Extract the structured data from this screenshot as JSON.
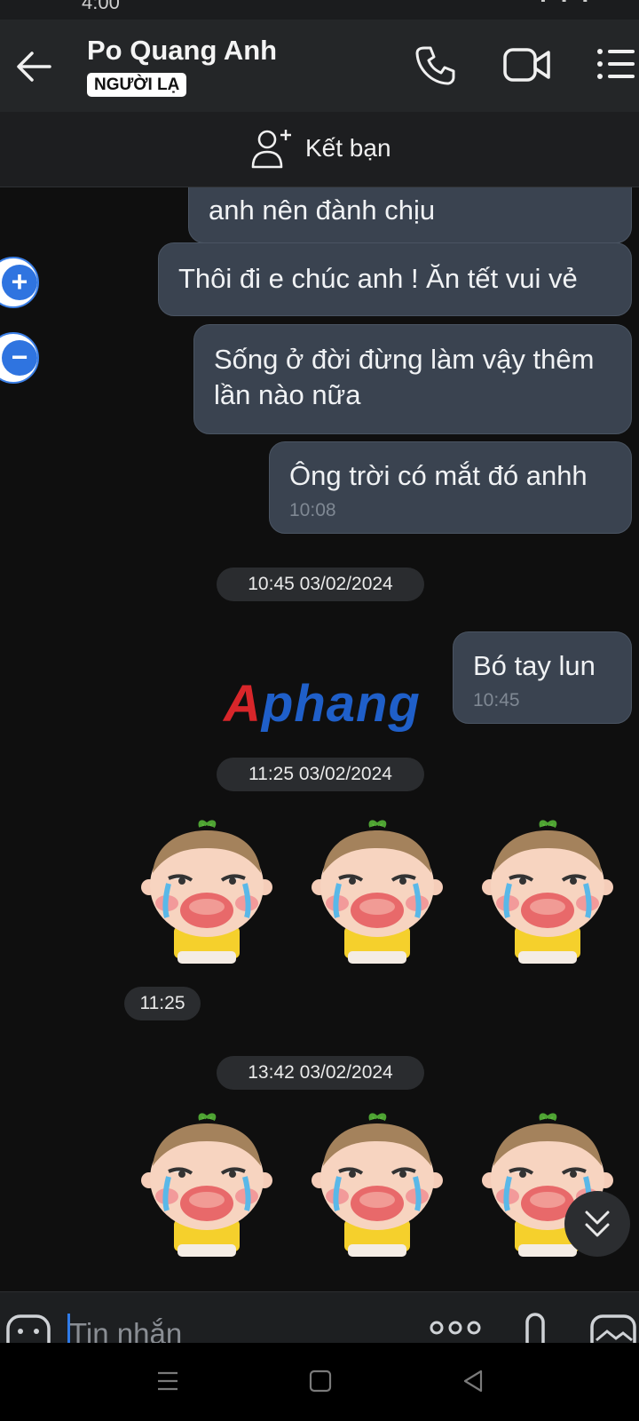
{
  "status_bar": {
    "time": "4:00"
  },
  "header": {
    "contact_name": "Po Quang Anh",
    "badge": "NGƯỜI LẠ",
    "icons": [
      "back-arrow-icon",
      "phone-icon",
      "video-call-icon",
      "menu-icon"
    ]
  },
  "add_friend": {
    "label": "Kết bạn",
    "icon": "add-person-icon"
  },
  "messages": [
    {
      "text": "anh nên đành chịu"
    },
    {
      "text": "Thôi đi e chúc anh ! Ăn tết vui vẻ"
    },
    {
      "line1": "Sống ở đời đừng làm vậy thêm",
      "line2": "lần nào nữa"
    },
    {
      "text": "Ông trời có mắt đó anhh",
      "time": "10:08"
    },
    {
      "text": "Bó tay lun",
      "time": "10:45"
    }
  ],
  "date_separators": [
    "10:45 03/02/2024",
    "11:25 03/02/2024",
    "13:42 03/02/2024"
  ],
  "sticker_time": "11:25",
  "watermark": {
    "text": "Aphang",
    "colors": [
      "#d8262a",
      "#1f5fc9"
    ]
  },
  "zoom_controls": {
    "plus": "+",
    "minus": "−"
  },
  "input": {
    "placeholder": "Tin nhắn"
  },
  "colors": {
    "bubble": "#3a4350",
    "accent": "#2f74e0",
    "background": "#0f0f0f"
  }
}
